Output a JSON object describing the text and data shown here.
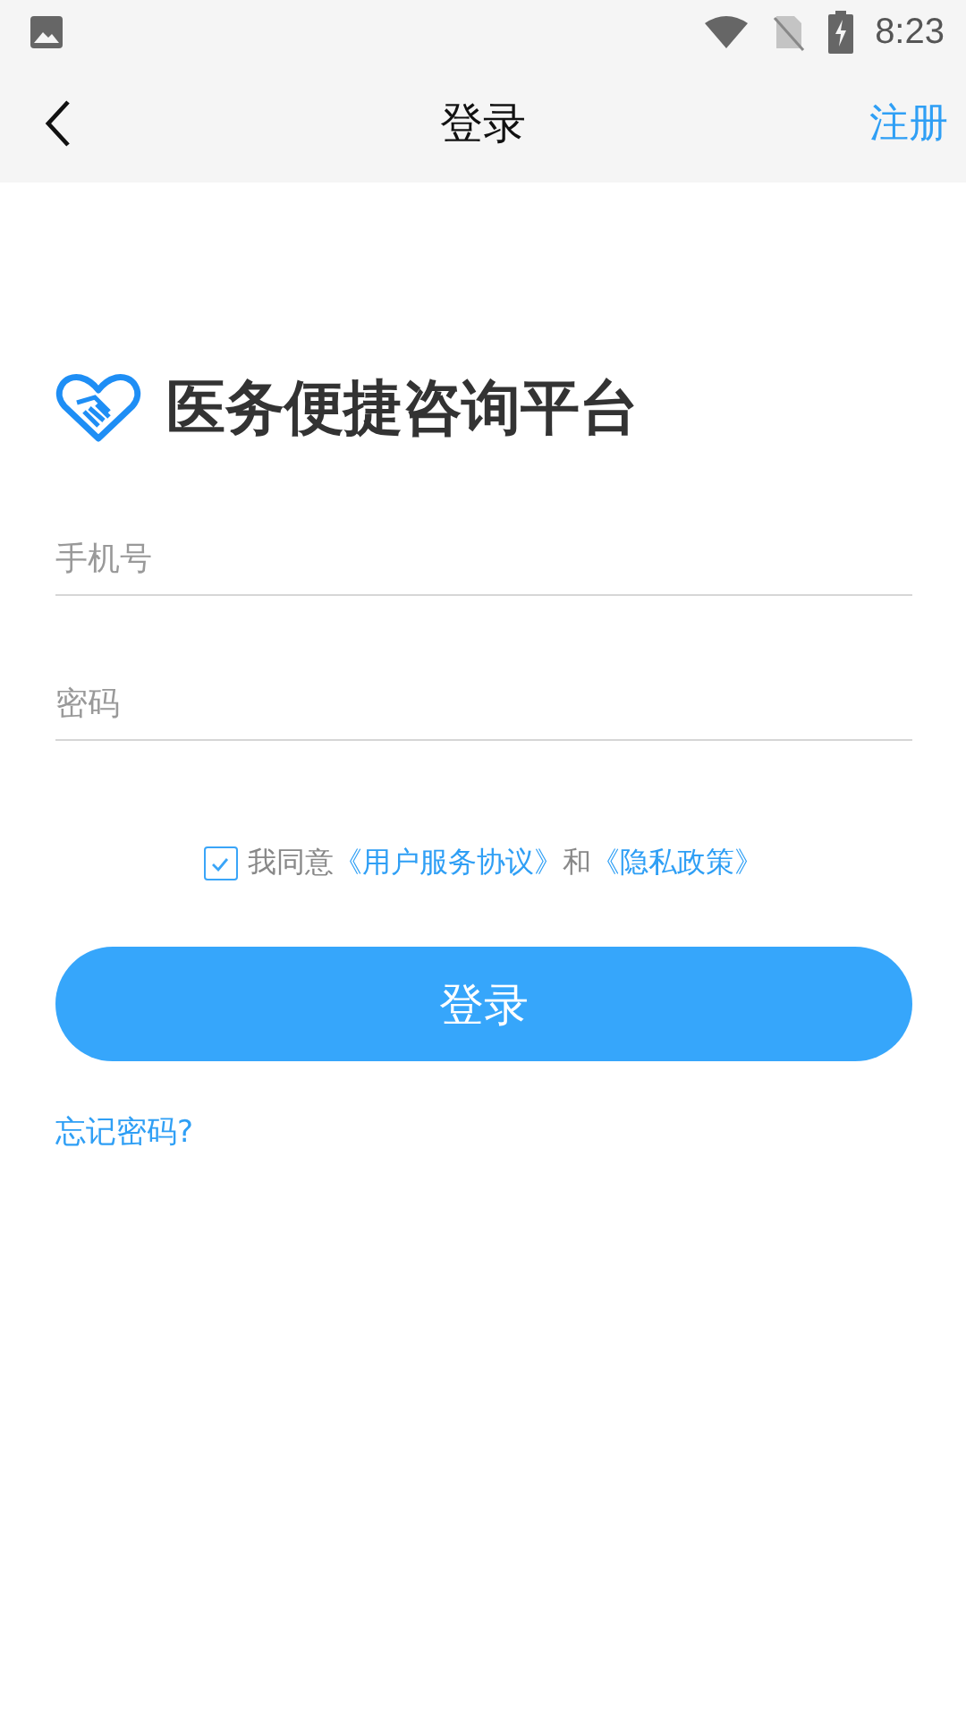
{
  "status_bar": {
    "time": "8:23"
  },
  "nav_bar": {
    "title": "登录",
    "action": "注册"
  },
  "brand": {
    "title": "医务便捷咨询平台"
  },
  "fields": [
    {
      "placeholder": "手机号"
    },
    {
      "placeholder": "密码"
    }
  ],
  "agreement": {
    "checked": true,
    "parts": [
      {
        "kind": "text",
        "text": "我同意"
      },
      {
        "kind": "link",
        "text": "《用户服务协议》"
      },
      {
        "kind": "text",
        "text": "和"
      },
      {
        "kind": "link",
        "text": "《隐私政策》"
      }
    ]
  },
  "login_button": "登录",
  "forgot_link": "忘记密码?"
}
